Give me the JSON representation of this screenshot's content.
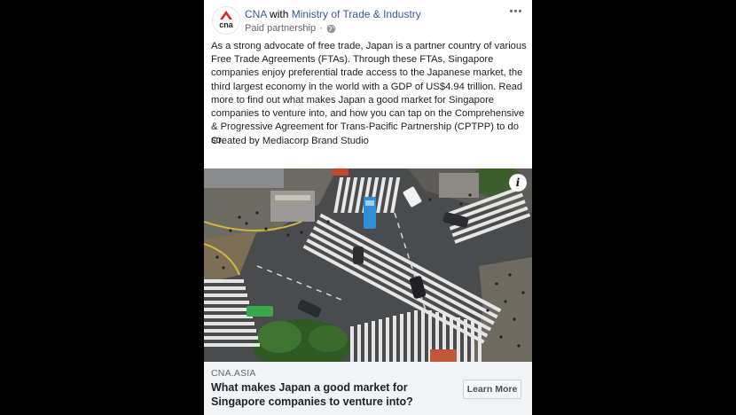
{
  "post": {
    "page_name": "CNA",
    "with_text": "with",
    "partner_name": "Ministry of Trade & Industry",
    "paid_partnership": "Paid partnership",
    "privacy_icon": "globe-icon",
    "more_icon": "more-options-icon",
    "body": "As a strong advocate of free trade, Japan is a partner country of various Free Trade Agreements (FTAs). Through these FTAs, Singapore companies enjoy preferential trade access to the Japanese market, the third largest economy in the world with a GDP of US$4.94 trillion. Read more to find out what makes Japan a good market for Singapore companies to venture into, and how you can tap on the Comprehensive & Progressive Agreement for Trans-Pacific Partnership (CPTPP) to do so.",
    "credit": "Created by Mediacorp Brand Studio"
  },
  "media": {
    "info_label": "i"
  },
  "link_preview": {
    "domain": "CNA.ASIA",
    "headline": "What makes Japan a good market for Singapore companies to venture into?",
    "cta_label": "Learn More"
  },
  "colors": {
    "link": "#385898",
    "brand_red": "#e2231a",
    "footer_bg": "#f2f3f5"
  }
}
